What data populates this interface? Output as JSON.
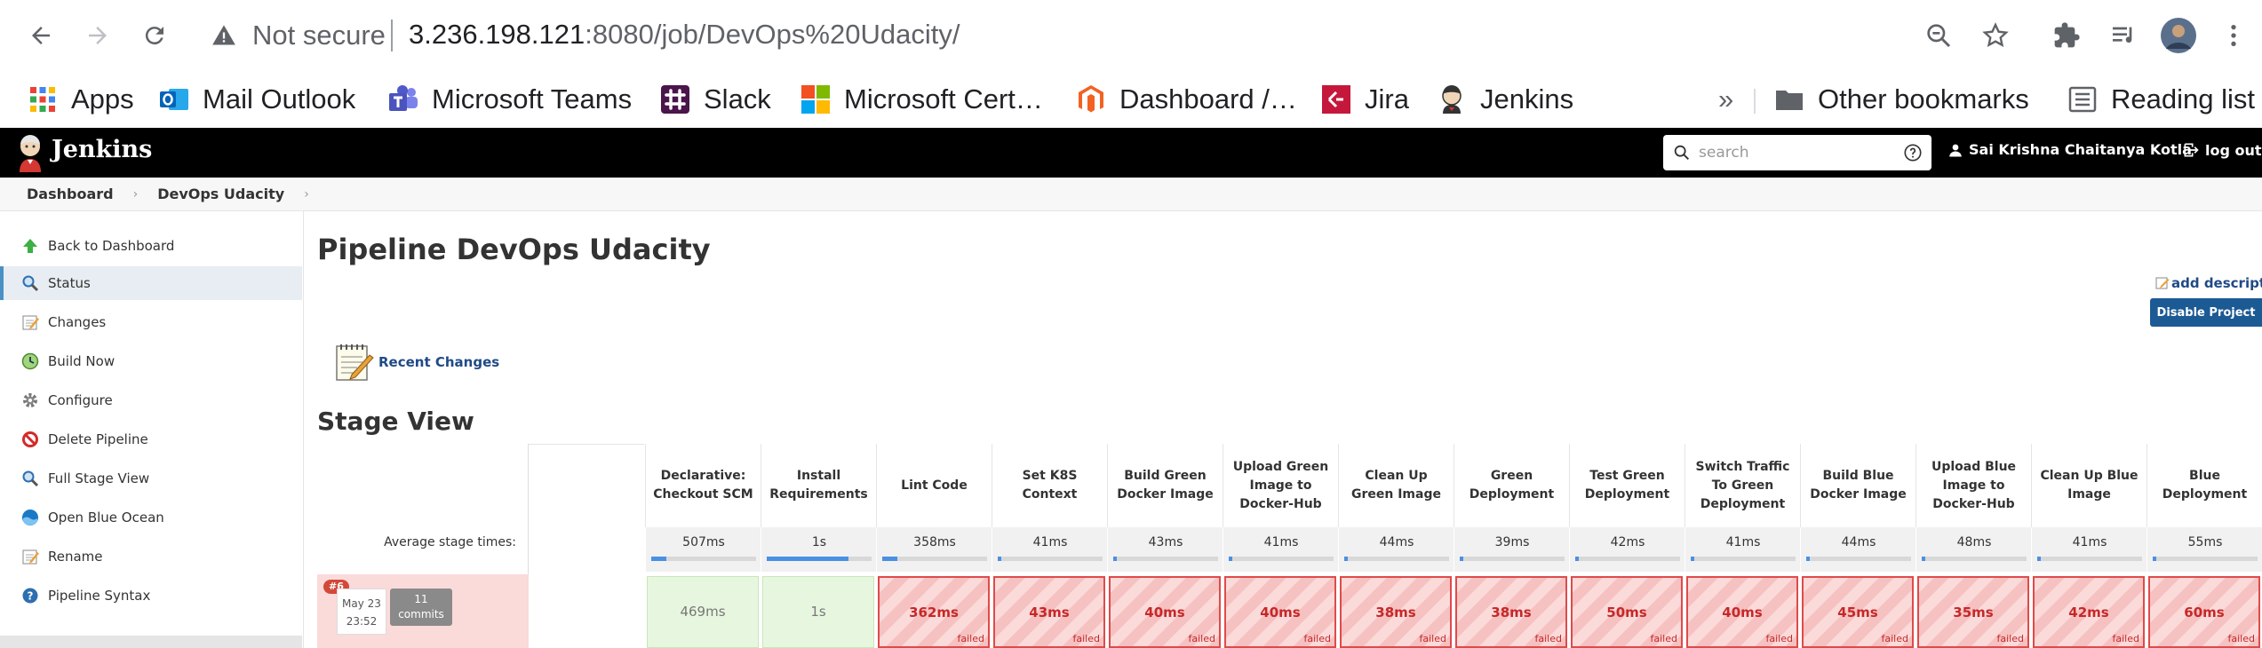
{
  "browser": {
    "security_label": "Not secure",
    "url_host": "3.236.198.121",
    "url_rest": ":8080/job/DevOps%20Udacity/",
    "bookmarks": [
      {
        "label": "Apps",
        "icon": "apps-grid-icon"
      },
      {
        "label": "Mail Outlook",
        "icon": "outlook-icon"
      },
      {
        "label": "Microsoft Teams",
        "icon": "teams-icon"
      },
      {
        "label": "Slack",
        "icon": "slack-icon"
      },
      {
        "label": "Microsoft Cert…",
        "icon": "microsoft-icon"
      },
      {
        "label": "Dashboard /…",
        "icon": "magento-icon"
      },
      {
        "label": "Jira",
        "icon": "jira-icon"
      },
      {
        "label": "Jenkins",
        "icon": "jenkins-icon"
      }
    ],
    "overflow": "»",
    "other_bookmarks": "Other bookmarks",
    "reading_list": "Reading list"
  },
  "header": {
    "title": "Jenkins",
    "search_placeholder": "search",
    "user": "Sai Krishna Chaitanya Kotla",
    "logout": "log out"
  },
  "breadcrumb": [
    "Dashboard",
    "DevOps Udacity"
  ],
  "sidebar": [
    {
      "label": "Back to Dashboard",
      "icon": "up-arrow-icon"
    },
    {
      "label": "Status",
      "icon": "magnifier-icon",
      "active": true
    },
    {
      "label": "Changes",
      "icon": "notepad-icon"
    },
    {
      "label": "Build Now",
      "icon": "clock-icon"
    },
    {
      "label": "Configure",
      "icon": "gear-icon"
    },
    {
      "label": "Delete Pipeline",
      "icon": "no-entry-icon"
    },
    {
      "label": "Full Stage View",
      "icon": "magnifier-icon"
    },
    {
      "label": "Open Blue Ocean",
      "icon": "blue-ocean-icon"
    },
    {
      "label": "Rename",
      "icon": "notepad-icon"
    },
    {
      "label": "Pipeline Syntax",
      "icon": "help-icon"
    }
  ],
  "main": {
    "title": "Pipeline DevOps Udacity",
    "add_description": "add description",
    "disable_button": "Disable Project",
    "recent_changes": "Recent Changes",
    "stage_view_title": "Stage View",
    "avg_label": "Average stage times:"
  },
  "build": {
    "number": "#6",
    "date": "May 23",
    "time": "23:52",
    "commits_count": "11",
    "commits_label": "commits"
  },
  "stages": [
    {
      "name": "Declarative: Checkout SCM",
      "avg": "507ms",
      "avg_fraction": 0.14,
      "run": "469ms",
      "status": "ok"
    },
    {
      "name": "Install Requirements",
      "avg": "1s",
      "avg_fraction": 0.78,
      "run": "1s",
      "status": "ok"
    },
    {
      "name": "Lint Code",
      "avg": "358ms",
      "avg_fraction": 0.14,
      "run": "362ms",
      "status": "failed"
    },
    {
      "name": "Set K8S Context",
      "avg": "41ms",
      "avg_fraction": 0.03,
      "run": "43ms",
      "status": "failed"
    },
    {
      "name": "Build Green Docker Image",
      "avg": "43ms",
      "avg_fraction": 0.03,
      "run": "40ms",
      "status": "failed"
    },
    {
      "name": "Upload Green Image to Docker-Hub",
      "avg": "41ms",
      "avg_fraction": 0.03,
      "run": "40ms",
      "status": "failed"
    },
    {
      "name": "Clean Up Green Image",
      "avg": "44ms",
      "avg_fraction": 0.03,
      "run": "38ms",
      "status": "failed"
    },
    {
      "name": "Green Deployment",
      "avg": "39ms",
      "avg_fraction": 0.03,
      "run": "38ms",
      "status": "failed"
    },
    {
      "name": "Test Green Deployment",
      "avg": "42ms",
      "avg_fraction": 0.03,
      "run": "50ms",
      "status": "failed"
    },
    {
      "name": "Switch Traffic To Green Deployment",
      "avg": "41ms",
      "avg_fraction": 0.03,
      "run": "40ms",
      "status": "failed"
    },
    {
      "name": "Build Blue Docker Image",
      "avg": "44ms",
      "avg_fraction": 0.03,
      "run": "45ms",
      "status": "failed"
    },
    {
      "name": "Upload Blue Image to Docker-Hub",
      "avg": "48ms",
      "avg_fraction": 0.03,
      "run": "35ms",
      "status": "failed"
    },
    {
      "name": "Clean Up Blue Image",
      "avg": "41ms",
      "avg_fraction": 0.03,
      "run": "42ms",
      "status": "failed"
    },
    {
      "name": "Blue Deployment",
      "avg": "55ms",
      "avg_fraction": 0.03,
      "run": "60ms",
      "status": "failed"
    }
  ],
  "status_text": {
    "failed": "failed"
  }
}
